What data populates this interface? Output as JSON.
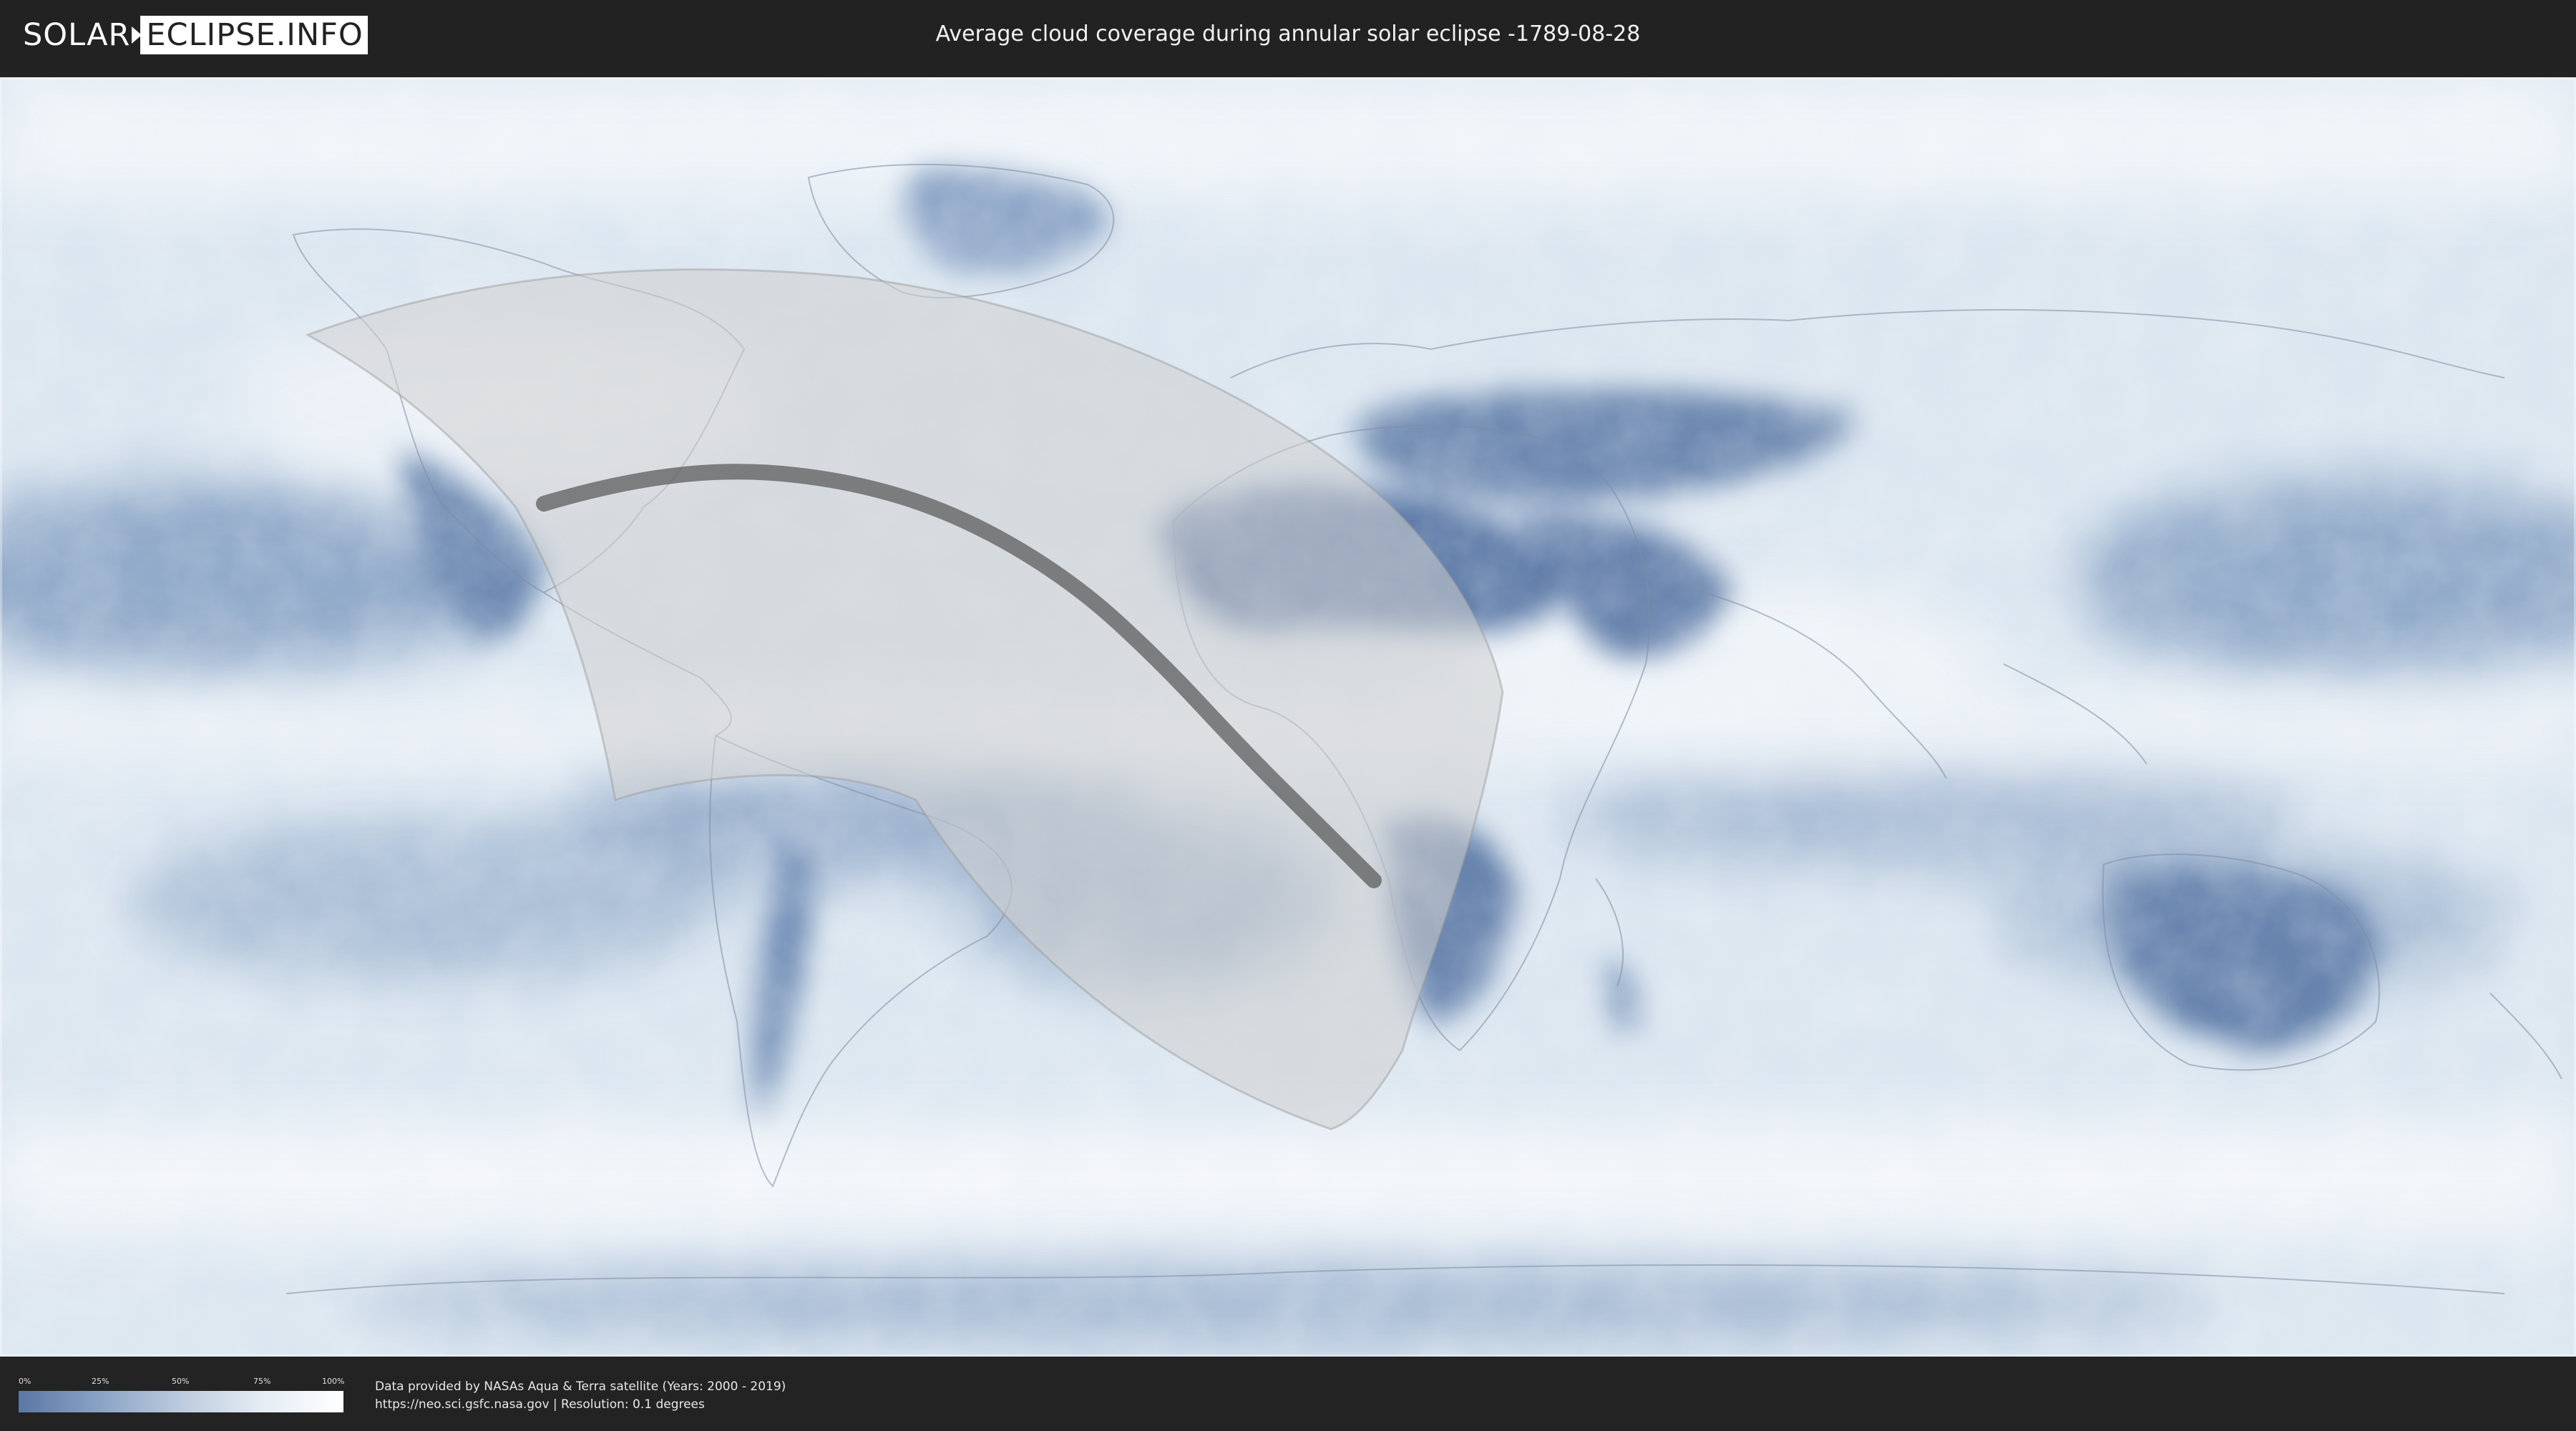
{
  "header": {
    "logo_part1": "SOLAR",
    "logo_part2": "ECLIPSE.INFO",
    "title": "Average cloud coverage during annular solar eclipse -1789-08-28"
  },
  "map": {
    "projection": "equirectangular",
    "layers": [
      "cloud-coverage",
      "country-borders",
      "eclipse-visibility-zone",
      "annularity-path"
    ],
    "annular_path": {
      "points": [
        {
          "lon": -104,
          "lat": 30
        },
        {
          "lon": -94,
          "lat": 33
        },
        {
          "lon": -77,
          "lat": 35
        },
        {
          "lon": -60,
          "lat": 33
        },
        {
          "lon": -45,
          "lat": 28
        },
        {
          "lon": -30,
          "lat": 19
        },
        {
          "lon": -18,
          "lat": 8
        },
        {
          "lon": -6,
          "lat": -5
        },
        {
          "lon": 4,
          "lat": -15
        },
        {
          "lon": 12,
          "lat": -23
        }
      ]
    },
    "colors": {
      "cloud_low": "#5b77a4",
      "cloud_high": "#ffffff",
      "ocean_base": "#dde7f0",
      "visibility_zone": "#c8c8c8",
      "annular_path": "#4a4a4a",
      "border": "#6f7f93"
    }
  },
  "legend": {
    "ticks": [
      "0%",
      "25%",
      "50%",
      "75%",
      "100%"
    ],
    "colors": [
      "#5b77a4",
      "#8aa3c5",
      "#bccbde",
      "#e5ecf4",
      "#ffffff"
    ]
  },
  "credit": {
    "line1": "Data provided by NASAs Aqua & Terra satellite (Years: 2000 - 2019)",
    "line2": "https://neo.sci.gsfc.nasa.gov | Resolution: 0.1 degrees"
  }
}
